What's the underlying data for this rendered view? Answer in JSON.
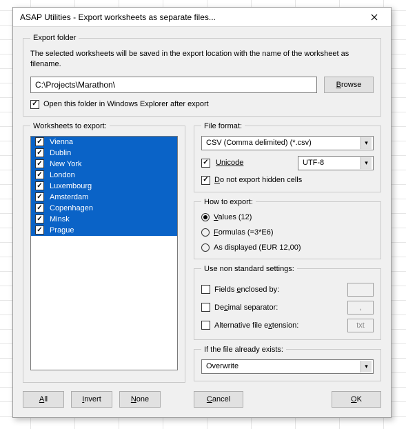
{
  "title": "ASAP Utilities - Export worksheets as separate files...",
  "export_folder": {
    "legend": "Export folder",
    "desc": "The selected worksheets will be saved in the export location with the name of the worksheet as filename.",
    "path": "C:\\Projects\\Marathon\\",
    "browse": "Browse",
    "open_after": "Open this folder in Windows Explorer after export"
  },
  "worksheets": {
    "legend": "Worksheets to export:",
    "items": [
      "Vienna",
      "Dublin",
      "New York",
      "London",
      "Luxembourg",
      "Amsterdam",
      "Copenhagen",
      "Minsk",
      "Prague"
    ],
    "all": "All",
    "invert": "Invert",
    "none": "None"
  },
  "file_format": {
    "legend": "File format:",
    "selected": "CSV (Comma delimited) (*.csv)",
    "unicode": "Unicode",
    "encoding": "UTF-8",
    "no_hidden": "Do not export hidden cells"
  },
  "how_to_export": {
    "legend": "How to export:",
    "values": "Values (12)",
    "formulas": "Formulas (=3*E6)",
    "as_displayed": "As displayed (EUR 12,00)"
  },
  "nonstd": {
    "legend": "Use non standard settings:",
    "fields_by": "Fields enclosed by:",
    "fields_val": "",
    "decimal": "Decimal separator:",
    "decimal_val": ",",
    "altext": "Alternative file extension:",
    "altext_val": "txt"
  },
  "exists": {
    "legend": "If the file already exists:",
    "selected": "Overwrite"
  },
  "buttons": {
    "cancel": "Cancel",
    "ok": "OK"
  }
}
